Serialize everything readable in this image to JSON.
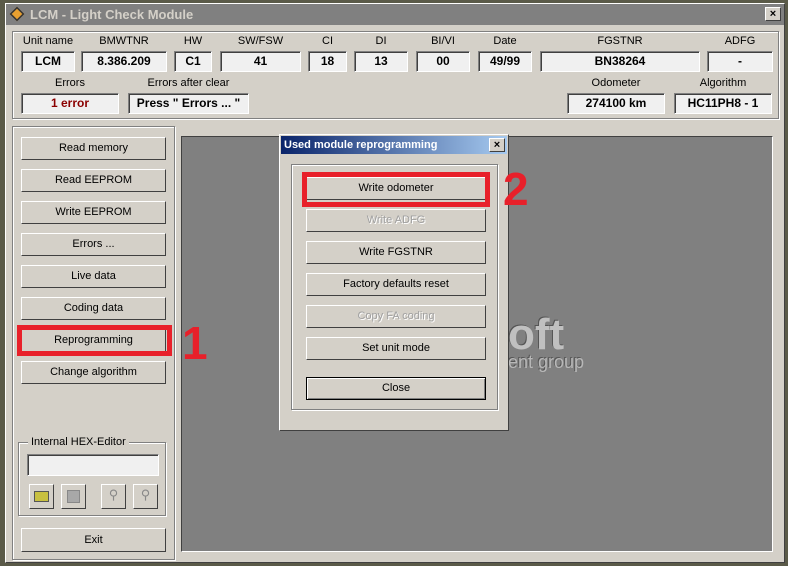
{
  "window": {
    "title": "LCM - Light Check Module",
    "close": "×"
  },
  "fields": [
    {
      "label": "Unit name",
      "value": "LCM"
    },
    {
      "label": "BMWTNR",
      "value": "8.386.209"
    },
    {
      "label": "HW",
      "value": "C1"
    },
    {
      "label": "SW/FSW",
      "value": "41"
    },
    {
      "label": "CI",
      "value": "18"
    },
    {
      "label": "DI",
      "value": "13"
    },
    {
      "label": "BI/VI",
      "value": "00"
    },
    {
      "label": "Date",
      "value": "49/99"
    },
    {
      "label": "FGSTNR",
      "value": "BN38264"
    },
    {
      "label": "ADFG",
      "value": "-"
    }
  ],
  "status": {
    "errors_label": "Errors",
    "errors_value": "1 error",
    "errors_color": "#8b0000",
    "after_clear_label": "Errors after clear",
    "after_clear_value": "Press \" Errors ... \"",
    "odometer_label": "Odometer",
    "odometer_value": "274100 km",
    "algorithm_label": "Algorithm",
    "algorithm_value": "HC11PH8 - 1"
  },
  "sidebar": {
    "buttons": [
      "Read memory",
      "Read EEPROM",
      "Write EEPROM",
      "Errors ...",
      "Live data",
      "Coding data",
      "Reprogramming",
      "Change algorithm"
    ],
    "hex_editor_label": "Internal HEX-Editor",
    "hex_input": "",
    "exit": "Exit"
  },
  "logo": {
    "line1": "oft",
    "line2": "ent group"
  },
  "dialog": {
    "title": "Used module reprogramming",
    "close": "×",
    "buttons": [
      {
        "label": "Write odometer",
        "enabled": true
      },
      {
        "label": "Write ADFG",
        "enabled": false
      },
      {
        "label": "Write FGSTNR",
        "enabled": true
      },
      {
        "label": "Factory defaults reset",
        "enabled": true
      },
      {
        "label": "Copy FA coding",
        "enabled": false
      },
      {
        "label": "Set unit mode",
        "enabled": true
      }
    ],
    "close_button": "Close"
  },
  "annotations": {
    "step1": "1",
    "step2": "2",
    "highlight_color": "#e8202a"
  }
}
